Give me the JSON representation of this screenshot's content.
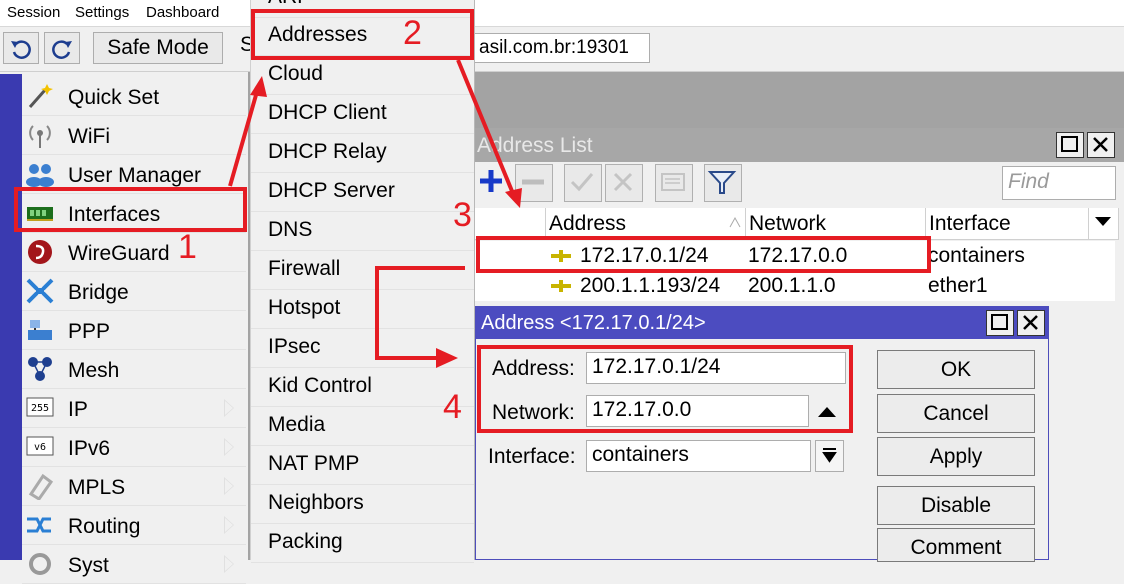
{
  "menubar": {
    "items": [
      "Session",
      "Settings",
      "Dashboard"
    ]
  },
  "toolbar": {
    "safe_mode_label": "Safe Mode",
    "partial_label": "S",
    "address_value": "asil.com.br:19301"
  },
  "sidebar": {
    "items": [
      {
        "label": "Quick Set",
        "icon": "wand-icon",
        "has_submenu": false
      },
      {
        "label": "WiFi",
        "icon": "wifi-icon",
        "has_submenu": false
      },
      {
        "label": "User Manager",
        "icon": "users-icon",
        "has_submenu": false
      },
      {
        "label": "Interfaces",
        "icon": "network-card-icon",
        "has_submenu": false
      },
      {
        "label": "WireGuard",
        "icon": "wireguard-icon",
        "has_submenu": false
      },
      {
        "label": "Bridge",
        "icon": "bridge-icon",
        "has_submenu": false
      },
      {
        "label": "PPP",
        "icon": "ppp-icon",
        "has_submenu": false
      },
      {
        "label": "Mesh",
        "icon": "mesh-icon",
        "has_submenu": false
      },
      {
        "label": "IP",
        "icon": "ip-255-icon",
        "has_submenu": true
      },
      {
        "label": "IPv6",
        "icon": "ipv6-icon",
        "has_submenu": true
      },
      {
        "label": "MPLS",
        "icon": "mpls-icon",
        "has_submenu": true
      },
      {
        "label": "Routing",
        "icon": "routing-icon",
        "has_submenu": true
      },
      {
        "label": "Syst",
        "icon": "gear-icon",
        "has_submenu": true
      }
    ]
  },
  "submenu": {
    "items": [
      "ARP",
      "Addresses",
      "Cloud",
      "DHCP Client",
      "DHCP Relay",
      "DHCP Server",
      "DNS",
      "Firewall",
      "Hotspot",
      "IPsec",
      "Kid Control",
      "Media",
      "NAT PMP",
      "Neighbors",
      "Packing"
    ]
  },
  "address_list": {
    "title": "Address List",
    "find_placeholder": "Find",
    "columns": [
      "Address",
      "Network",
      "Interface"
    ],
    "rows": [
      {
        "address": "172.17.0.1/24",
        "network": "172.17.0.0",
        "interface": "containers"
      },
      {
        "address": "200.1.1.193/24",
        "network": "200.1.1.0",
        "interface": "ether1"
      }
    ]
  },
  "dialog": {
    "title": "Address <172.17.0.1/24>",
    "address_label": "Address:",
    "address_value": "172.17.0.1/24",
    "network_label": "Network:",
    "network_value": "172.17.0.0",
    "interface_label": "Interface:",
    "interface_value": "containers",
    "buttons": [
      "OK",
      "Cancel",
      "Apply",
      "Disable",
      "Comment"
    ]
  },
  "annotations": [
    "1",
    "2",
    "3",
    "4"
  ],
  "colors": {
    "annotation": "#e51c23",
    "dialog_title": "#4c4cc0",
    "sidebar_strip": "#3a3ab0"
  }
}
